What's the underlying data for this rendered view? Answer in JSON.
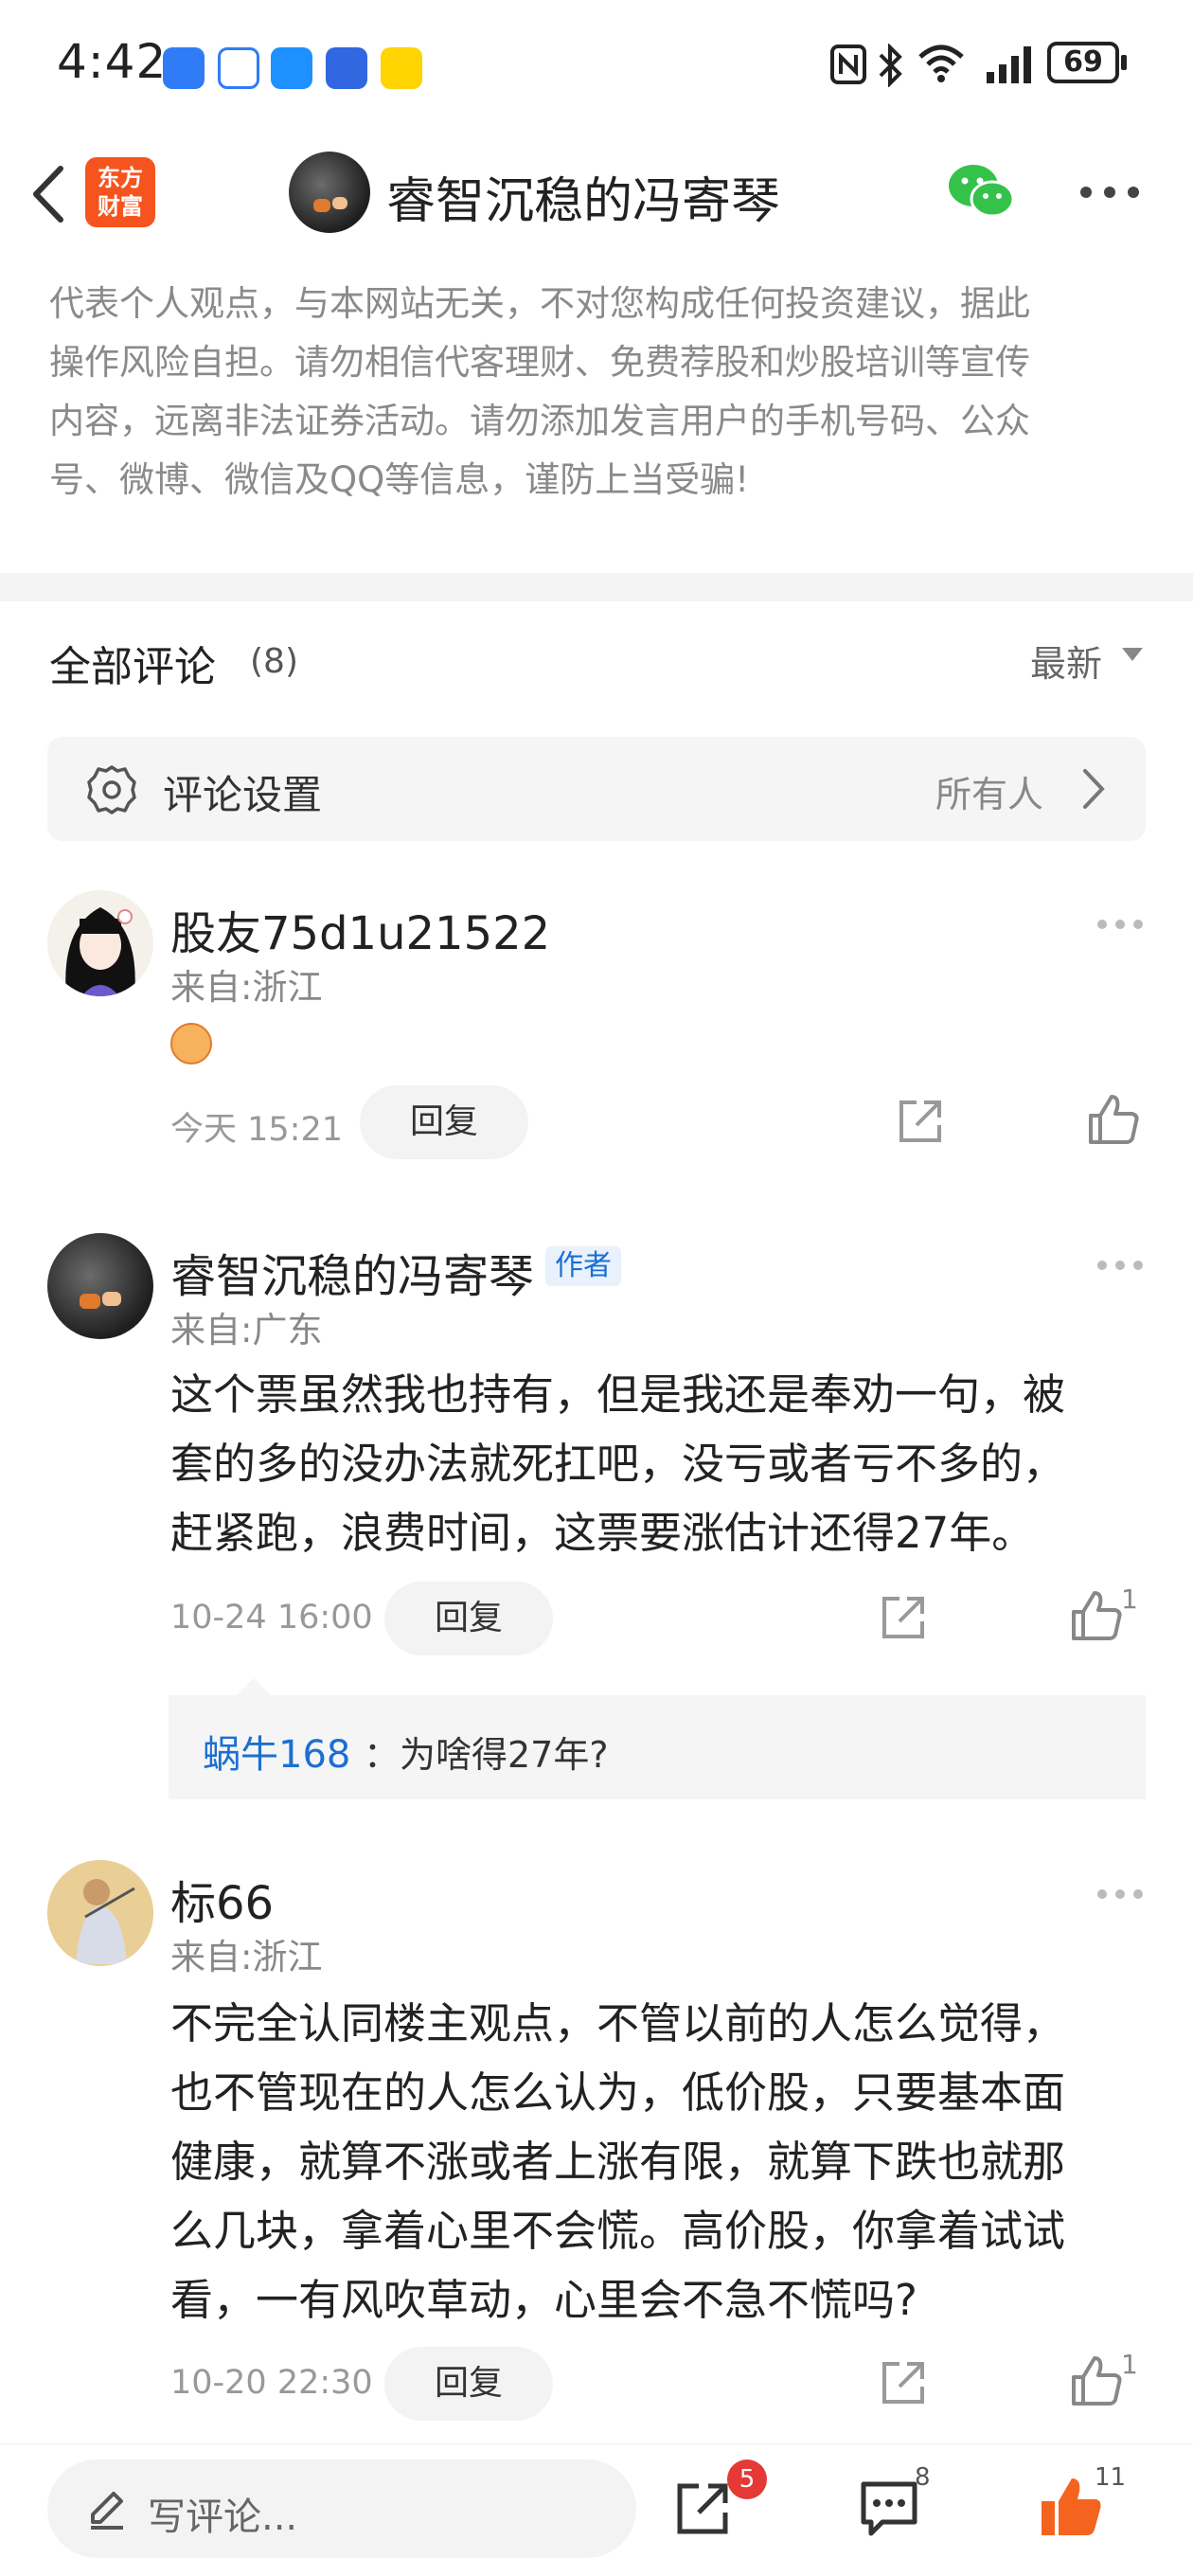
{
  "status_bar": {
    "time": "4:42",
    "battery": "69",
    "app_icons": [
      "k-icon",
      "baidu-icon",
      "message-icon",
      "shield-icon",
      "gamebox-icon"
    ]
  },
  "nav": {
    "logo_text": "东方财富",
    "logo_line1": "东方",
    "logo_line2": "财富",
    "title": "睿智沉稳的冯寄琴"
  },
  "disclaimer": {
    "lines": [
      "代表个人观点，与本网站无关，不对您构成任何投资建议，据此",
      "操作风险自担。请勿相信代客理财、免费荐股和炒股培训等宣传",
      "内容，远离非法证券活动。请勿添加发言用户的手机号码、公众",
      "号、微博、微信及QQ等信息，谨防上当受骗!"
    ]
  },
  "comments_header": {
    "title": "全部评论",
    "count": "(8)",
    "sort_label": "最新"
  },
  "settings": {
    "label": "评论设置",
    "value": "所有人"
  },
  "comments": [
    {
      "name": "股友75d1u21522",
      "location": "来自:浙江",
      "time": "今天 15:21",
      "reply_label": "回复",
      "likes": ""
    },
    {
      "name": "睿智沉稳的冯寄琴",
      "badge": "作者",
      "location": "来自:广东",
      "body_lines": [
        "这个票虽然我也持有，但是我还是奉劝一句，被",
        "套的多的没办法就死扛吧，没亏或者亏不多的，",
        "赶紧跑，浪费时间，这票要涨估计还得27年。"
      ],
      "time": "10-24 16:00",
      "reply_label": "回复",
      "likes": "1",
      "sub_reply": {
        "author": "蜗牛168",
        "text": "：为啥得27年?"
      }
    },
    {
      "name": "标66",
      "location": "来自:浙江",
      "body_lines": [
        "不完全认同楼主观点，不管以前的人怎么觉得，",
        "也不管现在的人怎么认为，低价股，只要基本面",
        "健康，就算不涨或者上涨有限，就算下跌也就那",
        "么几块，拿着心里不会慌。高价股，你拿着试试",
        "看，一有风吹草动，心里会不急不慌吗?"
      ],
      "time": "10-20 22:30",
      "reply_label": "回复",
      "likes": "1"
    }
  ],
  "bottom_bar": {
    "placeholder": "写评论...",
    "share_badge": "5",
    "comment_count": "8",
    "like_count": "11"
  },
  "colors": {
    "accent_orange": "#f5541e",
    "link_blue": "#1b6fd1",
    "badge_red": "#e53935"
  }
}
